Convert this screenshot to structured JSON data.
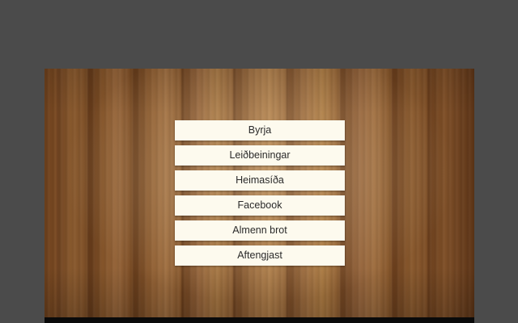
{
  "menu": {
    "items": [
      {
        "label": "Byrja"
      },
      {
        "label": "Leiðbeiningar"
      },
      {
        "label": "Heimasíða"
      },
      {
        "label": "Facebook"
      },
      {
        "label": "Almenn brot"
      },
      {
        "label": "Aftengjast"
      }
    ]
  },
  "colors": {
    "outer_background": "#4b4b4b",
    "button_background": "#fdfaee",
    "button_text": "#2a2a2a",
    "bottom_bar": "#0a0a0a"
  }
}
